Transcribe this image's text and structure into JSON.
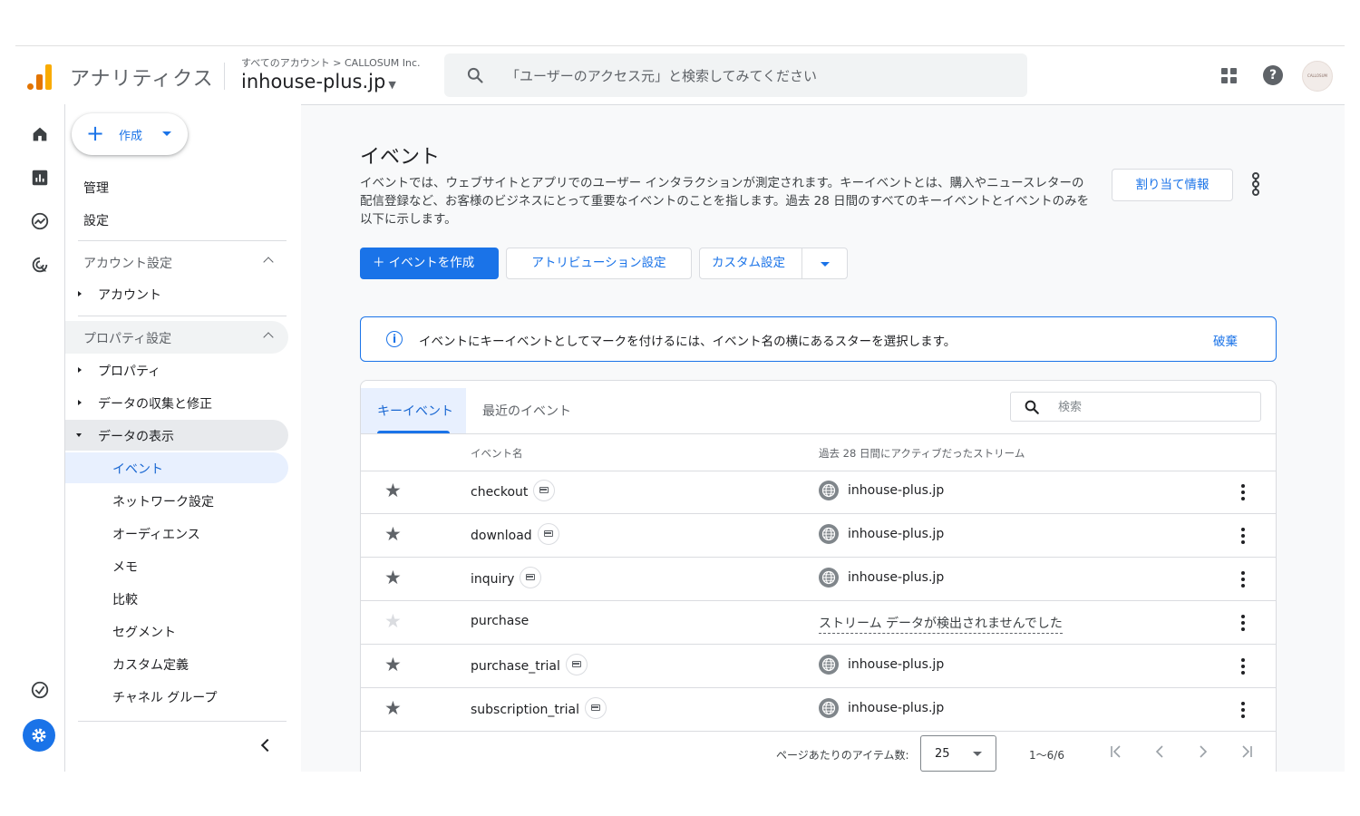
{
  "header": {
    "app_name": "アナリティクス",
    "breadcrumb": "すべてのアカウント > CALLOSUM Inc.",
    "property": "inhouse-plus.jp",
    "search_placeholder": "「ユーザーのアクセス元」と検索してみてください",
    "avatar_text": "CALLOSUM",
    "logo_icon": "analytics-logo-icon",
    "icons": [
      "search-icon",
      "apps-grid-icon",
      "help-icon"
    ]
  },
  "rail": {
    "icons": [
      "home-icon",
      "reports-icon",
      "explore-icon",
      "advertising-icon",
      "insights-check-icon",
      "admin-gear-icon"
    ]
  },
  "sidebar": {
    "create_label": "作成",
    "admin_label": "管理",
    "settings_label": "設定",
    "account_settings_label": "アカウント設定",
    "account_item": "アカウント",
    "property_settings_label": "プロパティ設定",
    "property_items": [
      "プロパティ",
      "データの収集と修正",
      "データの表示"
    ],
    "sub_items": [
      "イベント",
      "ネットワーク設定",
      "オーディエンス",
      "メモ",
      "比較",
      "セグメント",
      "カスタム定義",
      "チャネル グループ"
    ]
  },
  "main": {
    "title": "イベント",
    "description": "イベントでは、ウェブサイトとアプリでのユーザー インタラクションが測定されます。キーイベントとは、購入やニュースレターの配信登録など、お客様のビジネスにとって重要なイベントのことを指します。過去 28 日間のすべてのキーイベントとイベントのみを以下に示します。",
    "assign_button": "割り当て情報",
    "create_event_button": "＋ イベントを作成",
    "attribution_button": "アトリビューション設定",
    "custom_button": "カスタム設定",
    "banner_message": "イベントにキーイベントとしてマークを付けるには、イベント名の横にあるスターを選択します。",
    "banner_dismiss": "破棄",
    "tabs": [
      "キーイベント",
      "最近のイベント"
    ],
    "table_search_placeholder": "検索",
    "columns": [
      "イベント名",
      "過去 28 日間にアクティブだったストリーム"
    ],
    "rows": [
      {
        "name": "checkout",
        "starred": true,
        "has_badge": true,
        "stream": "inhouse-plus.jp"
      },
      {
        "name": "download",
        "starred": true,
        "has_badge": true,
        "stream": "inhouse-plus.jp"
      },
      {
        "name": "inquiry",
        "starred": true,
        "has_badge": true,
        "stream": "inhouse-plus.jp"
      },
      {
        "name": "purchase",
        "starred": false,
        "has_badge": false,
        "stream": "ストリーム データが検出されませんでした"
      },
      {
        "name": "purchase_trial",
        "starred": true,
        "has_badge": true,
        "stream": "inhouse-plus.jp"
      },
      {
        "name": "subscription_trial",
        "starred": true,
        "has_badge": true,
        "stream": "inhouse-plus.jp"
      }
    ],
    "pager_label": "ページあたりのアイテム数:",
    "page_size": "25",
    "range": "1〜6/6"
  },
  "colors": {
    "accent": "#1a73e8",
    "active_bg": "#e8f0fe",
    "logo_orange": "#e37400",
    "logo_yellow": "#f9ab00"
  }
}
